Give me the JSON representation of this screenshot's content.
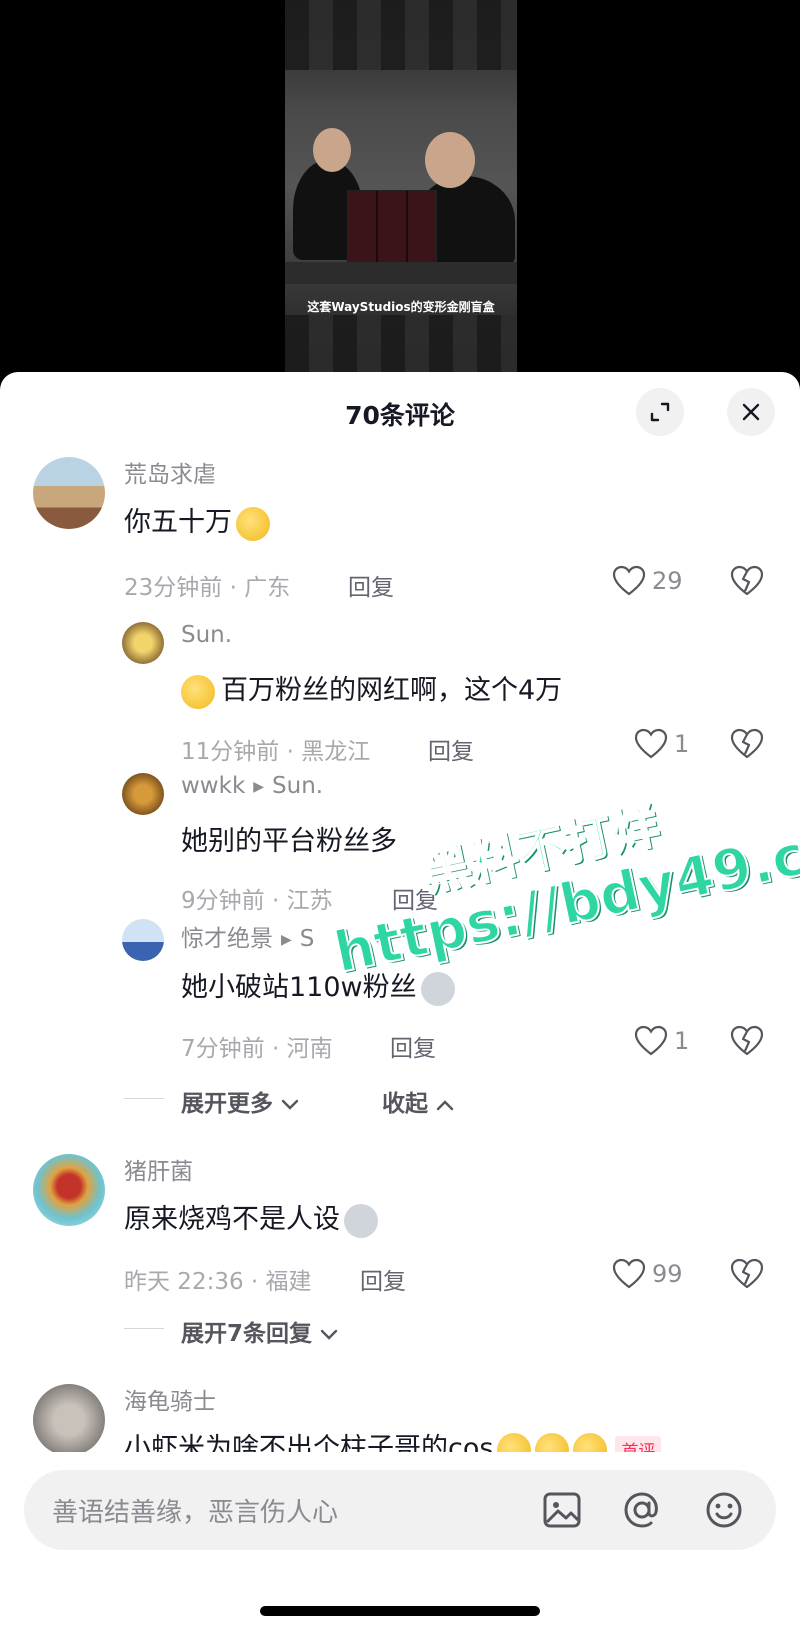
{
  "video": {
    "caption": "这套WayStudios的变形金刚盲盒"
  },
  "sheet": {
    "title": "70条评论"
  },
  "comments": [
    {
      "username": "荒岛求虐",
      "text": "你五十万",
      "time": "23分钟前",
      "location": "广东",
      "reply": "回复",
      "likes": "29"
    },
    {
      "username": "Sun.",
      "text": "百万粉丝的网红啊，这个4万",
      "time": "11分钟前",
      "location": "黑龙江",
      "reply": "回复",
      "likes": "1"
    },
    {
      "username": "wwkk",
      "reply_to": "Sun.",
      "text": "她别的平台粉丝多",
      "time": "9分钟前",
      "location": "江苏",
      "reply": "回复"
    },
    {
      "username": "惊才绝景",
      "reply_to": "S",
      "text": "她小破站110w粉丝",
      "time": "7分钟前",
      "location": "河南",
      "reply": "回复",
      "likes": "1"
    },
    {
      "username": "猪肝菌",
      "text": "原来烧鸡不是人设",
      "time": "昨天 22:36",
      "location": "福建",
      "reply": "回复",
      "likes": "99"
    },
    {
      "username": "海龟骑士",
      "text": "小虾米为啥不出个柱子哥的cos",
      "badge": "首评"
    }
  ],
  "expanders": {
    "more": "展开更多",
    "collapse": "收起",
    "replies": "展开7条回复"
  },
  "watermark": {
    "line1": "黑料不打烊",
    "line2": "https://bdy49.co"
  },
  "input": {
    "placeholder": "善语结善缘，恶言伤人心"
  },
  "icons": [
    "expand-icon",
    "close-icon",
    "heart-icon",
    "broken-heart-icon",
    "image-icon",
    "at-icon",
    "emoji-icon",
    "chevron-down-icon",
    "chevron-up-icon",
    "play-arrow-icon"
  ],
  "colors": {
    "accent": "#fe2c55",
    "watermark": "#2ed6a3",
    "text": "#161823",
    "muted": "#8a8b91"
  }
}
